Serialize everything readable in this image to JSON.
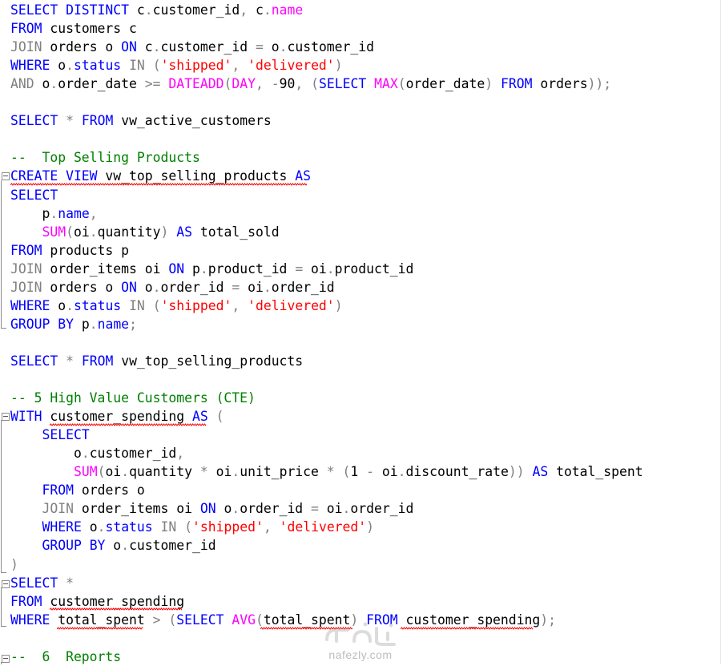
{
  "editor": {
    "lines": [
      [
        [
          "k",
          "SELECT DISTINCT"
        ],
        [
          "t",
          " c"
        ],
        [
          "g",
          "."
        ],
        [
          "t",
          "customer_id"
        ],
        [
          "g",
          ","
        ],
        [
          "t",
          " c"
        ],
        [
          "g",
          "."
        ],
        [
          "m",
          "name"
        ]
      ],
      [
        [
          "k",
          "FROM"
        ],
        [
          "t",
          " customers c"
        ]
      ],
      [
        [
          "g",
          "JOIN"
        ],
        [
          "t",
          " orders o "
        ],
        [
          "k",
          "ON"
        ],
        [
          "t",
          " c"
        ],
        [
          "g",
          "."
        ],
        [
          "t",
          "customer_id "
        ],
        [
          "g",
          "="
        ],
        [
          "t",
          " o"
        ],
        [
          "g",
          "."
        ],
        [
          "t",
          "customer_id"
        ]
      ],
      [
        [
          "k",
          "WHERE"
        ],
        [
          "t",
          " o"
        ],
        [
          "g",
          "."
        ],
        [
          "k",
          "status"
        ],
        [
          "t",
          " "
        ],
        [
          "g",
          "IN"
        ],
        [
          "t",
          " "
        ],
        [
          "g",
          "("
        ],
        [
          "s",
          "'shipped'"
        ],
        [
          "g",
          ","
        ],
        [
          "t",
          " "
        ],
        [
          "s",
          "'delivered'"
        ],
        [
          "g",
          ")"
        ]
      ],
      [
        [
          "g",
          "AND"
        ],
        [
          "t",
          " o"
        ],
        [
          "g",
          "."
        ],
        [
          "t",
          "order_date "
        ],
        [
          "g",
          ">="
        ],
        [
          "t",
          " "
        ],
        [
          "m",
          "DATEADD"
        ],
        [
          "g",
          "("
        ],
        [
          "m",
          "DAY"
        ],
        [
          "g",
          ","
        ],
        [
          "t",
          " "
        ],
        [
          "g",
          "-"
        ],
        [
          "t",
          "90"
        ],
        [
          "g",
          ","
        ],
        [
          "t",
          " "
        ],
        [
          "g",
          "("
        ],
        [
          "k",
          "SELECT"
        ],
        [
          "t",
          " "
        ],
        [
          "m",
          "MAX"
        ],
        [
          "g",
          "("
        ],
        [
          "t",
          "order_date"
        ],
        [
          "g",
          ")"
        ],
        [
          "t",
          " "
        ],
        [
          "k",
          "FROM"
        ],
        [
          "t",
          " orders"
        ],
        [
          "g",
          "));"
        ]
      ],
      [],
      [
        [
          "k",
          "SELECT"
        ],
        [
          "t",
          " "
        ],
        [
          "g",
          "*"
        ],
        [
          "t",
          " "
        ],
        [
          "k",
          "FROM"
        ],
        [
          "t",
          " vw_active_customers"
        ]
      ],
      [],
      [
        [
          "c",
          "--  Top Selling Products"
        ]
      ],
      [
        [
          "k",
          "CREATE VIEW"
        ],
        [
          "t",
          " vw_top_selling_products "
        ],
        [
          "k",
          "AS"
        ]
      ],
      [
        [
          "k",
          "SELECT"
        ]
      ],
      [
        [
          "t",
          "    p"
        ],
        [
          "g",
          "."
        ],
        [
          "k",
          "name"
        ],
        [
          "g",
          ","
        ]
      ],
      [
        [
          "t",
          "    "
        ],
        [
          "m",
          "SUM"
        ],
        [
          "g",
          "("
        ],
        [
          "t",
          "oi"
        ],
        [
          "g",
          "."
        ],
        [
          "t",
          "quantity"
        ],
        [
          "g",
          ")"
        ],
        [
          "t",
          " "
        ],
        [
          "k",
          "AS"
        ],
        [
          "t",
          " total_sold"
        ]
      ],
      [
        [
          "k",
          "FROM"
        ],
        [
          "t",
          " products p"
        ]
      ],
      [
        [
          "g",
          "JOIN"
        ],
        [
          "t",
          " order_items oi "
        ],
        [
          "k",
          "ON"
        ],
        [
          "t",
          " p"
        ],
        [
          "g",
          "."
        ],
        [
          "t",
          "product_id "
        ],
        [
          "g",
          "="
        ],
        [
          "t",
          " oi"
        ],
        [
          "g",
          "."
        ],
        [
          "t",
          "product_id"
        ]
      ],
      [
        [
          "g",
          "JOIN"
        ],
        [
          "t",
          " orders o "
        ],
        [
          "k",
          "ON"
        ],
        [
          "t",
          " o"
        ],
        [
          "g",
          "."
        ],
        [
          "t",
          "order_id "
        ],
        [
          "g",
          "="
        ],
        [
          "t",
          " oi"
        ],
        [
          "g",
          "."
        ],
        [
          "t",
          "order_id"
        ]
      ],
      [
        [
          "k",
          "WHERE"
        ],
        [
          "t",
          " o"
        ],
        [
          "g",
          "."
        ],
        [
          "k",
          "status"
        ],
        [
          "t",
          " "
        ],
        [
          "g",
          "IN"
        ],
        [
          "t",
          " "
        ],
        [
          "g",
          "("
        ],
        [
          "s",
          "'shipped'"
        ],
        [
          "g",
          ","
        ],
        [
          "t",
          " "
        ],
        [
          "s",
          "'delivered'"
        ],
        [
          "g",
          ")"
        ]
      ],
      [
        [
          "k",
          "GROUP BY"
        ],
        [
          "t",
          " p"
        ],
        [
          "g",
          "."
        ],
        [
          "k",
          "name"
        ],
        [
          "g",
          ";"
        ]
      ],
      [],
      [
        [
          "k",
          "SELECT"
        ],
        [
          "t",
          " "
        ],
        [
          "g",
          "*"
        ],
        [
          "t",
          " "
        ],
        [
          "k",
          "FROM"
        ],
        [
          "t",
          " vw_top_selling_products"
        ]
      ],
      [],
      [
        [
          "c",
          "-- 5 High Value Customers (CTE)"
        ]
      ],
      [
        [
          "k",
          "WITH"
        ],
        [
          "t",
          " customer_spending "
        ],
        [
          "k",
          "AS"
        ],
        [
          "t",
          " "
        ],
        [
          "g",
          "("
        ]
      ],
      [
        [
          "t",
          "    "
        ],
        [
          "k",
          "SELECT"
        ]
      ],
      [
        [
          "t",
          "        o"
        ],
        [
          "g",
          "."
        ],
        [
          "t",
          "customer_id"
        ],
        [
          "g",
          ","
        ]
      ],
      [
        [
          "t",
          "        "
        ],
        [
          "m",
          "SUM"
        ],
        [
          "g",
          "("
        ],
        [
          "t",
          "oi"
        ],
        [
          "g",
          "."
        ],
        [
          "t",
          "quantity "
        ],
        [
          "g",
          "*"
        ],
        [
          "t",
          " oi"
        ],
        [
          "g",
          "."
        ],
        [
          "t",
          "unit_price "
        ],
        [
          "g",
          "*"
        ],
        [
          "t",
          " "
        ],
        [
          "g",
          "("
        ],
        [
          "t",
          "1 "
        ],
        [
          "g",
          "-"
        ],
        [
          "t",
          " oi"
        ],
        [
          "g",
          "."
        ],
        [
          "t",
          "discount_rate"
        ],
        [
          "g",
          "))"
        ],
        [
          "t",
          " "
        ],
        [
          "k",
          "AS"
        ],
        [
          "t",
          " total_spent"
        ]
      ],
      [
        [
          "t",
          "    "
        ],
        [
          "k",
          "FROM"
        ],
        [
          "t",
          " orders o"
        ]
      ],
      [
        [
          "t",
          "    "
        ],
        [
          "g",
          "JOIN"
        ],
        [
          "t",
          " order_items oi "
        ],
        [
          "k",
          "ON"
        ],
        [
          "t",
          " o"
        ],
        [
          "g",
          "."
        ],
        [
          "t",
          "order_id "
        ],
        [
          "g",
          "="
        ],
        [
          "t",
          " oi"
        ],
        [
          "g",
          "."
        ],
        [
          "t",
          "order_id"
        ]
      ],
      [
        [
          "t",
          "    "
        ],
        [
          "k",
          "WHERE"
        ],
        [
          "t",
          " o"
        ],
        [
          "g",
          "."
        ],
        [
          "k",
          "status"
        ],
        [
          "t",
          " "
        ],
        [
          "g",
          "IN"
        ],
        [
          "t",
          " "
        ],
        [
          "g",
          "("
        ],
        [
          "s",
          "'shipped'"
        ],
        [
          "g",
          ","
        ],
        [
          "t",
          " "
        ],
        [
          "s",
          "'delivered'"
        ],
        [
          "g",
          ")"
        ]
      ],
      [
        [
          "t",
          "    "
        ],
        [
          "k",
          "GROUP BY"
        ],
        [
          "t",
          " o"
        ],
        [
          "g",
          "."
        ],
        [
          "t",
          "customer_id"
        ]
      ],
      [
        [
          "g",
          ")"
        ]
      ],
      [
        [
          "k",
          "SELECT"
        ],
        [
          "t",
          " "
        ],
        [
          "g",
          "*"
        ]
      ],
      [
        [
          "k",
          "FROM"
        ],
        [
          "t",
          " customer_spending"
        ]
      ],
      [
        [
          "k",
          "WHERE"
        ],
        [
          "t",
          " total_spent "
        ],
        [
          "g",
          ">"
        ],
        [
          "t",
          " "
        ],
        [
          "g",
          "("
        ],
        [
          "k",
          "SELECT"
        ],
        [
          "t",
          " "
        ],
        [
          "m",
          "AVG"
        ],
        [
          "g",
          "("
        ],
        [
          "t",
          "total_spent"
        ],
        [
          "g",
          ")"
        ],
        [
          "t",
          " "
        ],
        [
          "k",
          "FROM"
        ],
        [
          "t",
          " customer_spending"
        ],
        [
          "g",
          ");"
        ]
      ],
      [],
      [
        [
          "c",
          "--  6  Reports"
        ]
      ]
    ]
  },
  "watermark": {
    "text": "nafezly.com"
  }
}
